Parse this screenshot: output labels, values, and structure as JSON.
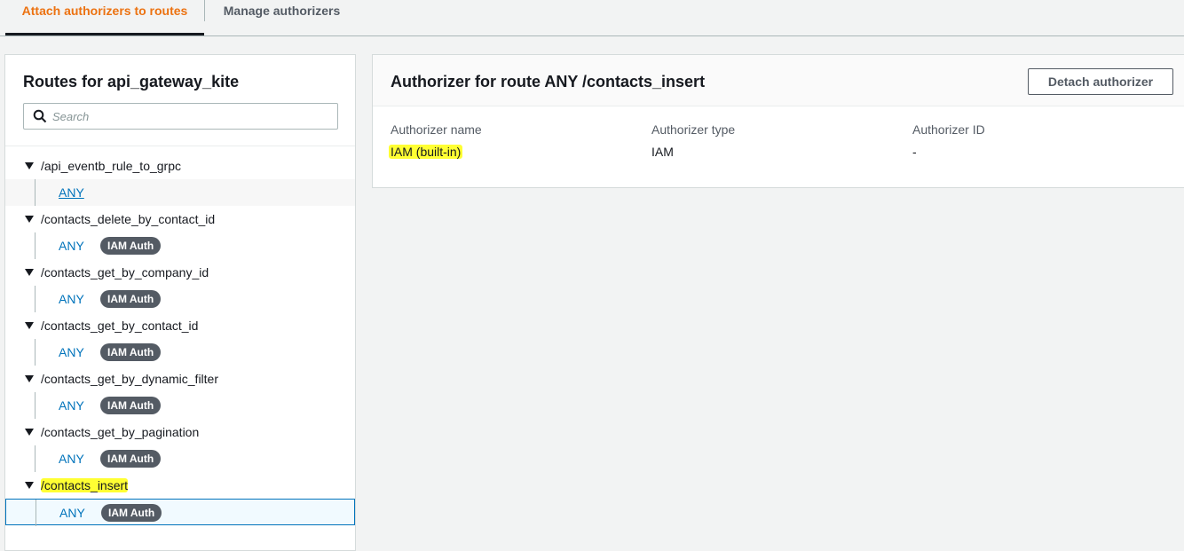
{
  "tabs": {
    "attach_label": "Attach authorizers to routes",
    "manage_label": "Manage authorizers"
  },
  "routes_panel": {
    "title": "Routes for api_gateway_kite",
    "search_placeholder": "Search",
    "routes": [
      {
        "path": "/api_eventb_rule_to_grpc",
        "method": "ANY",
        "badge": ""
      },
      {
        "path": "/contacts_delete_by_contact_id",
        "method": "ANY",
        "badge": "IAM Auth"
      },
      {
        "path": "/contacts_get_by_company_id",
        "method": "ANY",
        "badge": "IAM Auth"
      },
      {
        "path": "/contacts_get_by_contact_id",
        "method": "ANY",
        "badge": "IAM Auth"
      },
      {
        "path": "/contacts_get_by_dynamic_filter",
        "method": "ANY",
        "badge": "IAM Auth"
      },
      {
        "path": "/contacts_get_by_pagination",
        "method": "ANY",
        "badge": "IAM Auth"
      },
      {
        "path": "/contacts_insert",
        "method": "ANY",
        "badge": "IAM Auth"
      }
    ]
  },
  "authorizer_panel": {
    "title": "Authorizer for route ANY /contacts_insert",
    "detach_label": "Detach authorizer",
    "name_label": "Authorizer name",
    "name_value": "IAM (built-in)",
    "type_label": "Authorizer type",
    "type_value": "IAM",
    "id_label": "Authorizer ID",
    "id_value": "-"
  },
  "colors": {
    "accent_orange": "#ec7211",
    "link_blue": "#0073bb",
    "badge_gray": "#545b64",
    "highlight_yellow": "#ffff33"
  }
}
